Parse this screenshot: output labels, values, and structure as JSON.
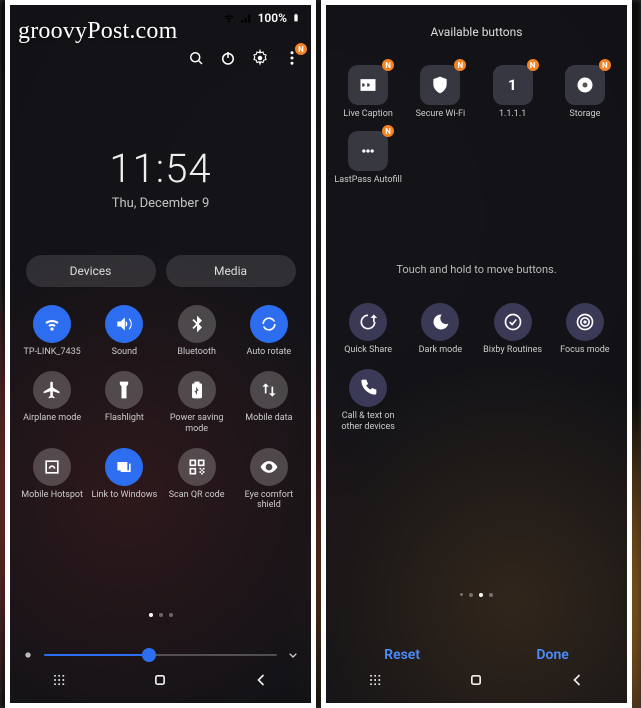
{
  "watermark": "groovyPost.com",
  "status": {
    "battery_pct": "100%"
  },
  "clock": {
    "time": "11:54",
    "date": "Thu, December 9"
  },
  "pills": {
    "devices": "Devices",
    "media": "Media"
  },
  "qs": [
    {
      "id": "wifi",
      "label": "TP-LINK_7435",
      "active": true,
      "icon": "wifi"
    },
    {
      "id": "sound",
      "label": "Sound",
      "active": true,
      "icon": "sound"
    },
    {
      "id": "bluetooth",
      "label": "Bluetooth",
      "active": false,
      "icon": "bluetooth"
    },
    {
      "id": "auto-rotate",
      "label": "Auto rotate",
      "active": true,
      "icon": "rotate"
    },
    {
      "id": "airplane",
      "label": "Airplane mode",
      "active": false,
      "icon": "airplane"
    },
    {
      "id": "flashlight",
      "label": "Flashlight",
      "active": false,
      "icon": "flashlight"
    },
    {
      "id": "power-saving",
      "label": "Power saving mode",
      "active": false,
      "icon": "battery"
    },
    {
      "id": "mobile-data",
      "label": "Mobile data",
      "active": false,
      "icon": "data"
    },
    {
      "id": "hotspot",
      "label": "Mobile Hotspot",
      "active": false,
      "icon": "hotspot"
    },
    {
      "id": "link-windows",
      "label": "Link to Windows",
      "active": true,
      "icon": "link"
    },
    {
      "id": "scan-qr",
      "label": "Scan QR code",
      "active": false,
      "icon": "qr"
    },
    {
      "id": "eye-comfort",
      "label": "Eye comfort shield",
      "active": false,
      "icon": "eye"
    }
  ],
  "brightness": {
    "value": 45
  },
  "right": {
    "available_title": "Available buttons",
    "hint": "Touch and hold to move buttons.",
    "reset": "Reset",
    "done": "Done",
    "available": [
      {
        "id": "live-caption",
        "label": "Live Caption",
        "icon": "cc"
      },
      {
        "id": "secure-wifi",
        "label": "Secure Wi-Fi",
        "icon": "shield"
      },
      {
        "id": "1111",
        "label": "1.1.1.1",
        "icon": "one"
      },
      {
        "id": "storage",
        "label": "Storage",
        "icon": "disc"
      },
      {
        "id": "lastpass",
        "label": "LastPass Autofill",
        "icon": "dots"
      }
    ],
    "editing": [
      {
        "id": "quick-share",
        "label": "Quick Share",
        "icon": "share"
      },
      {
        "id": "dark-mode",
        "label": "Dark mode",
        "icon": "moon"
      },
      {
        "id": "bixby",
        "label": "Bixby Routines",
        "icon": "check"
      },
      {
        "id": "focus-mode",
        "label": "Focus mode",
        "icon": "target"
      },
      {
        "id": "call-text",
        "label": "Call & text on other devices",
        "icon": "phone"
      }
    ]
  }
}
